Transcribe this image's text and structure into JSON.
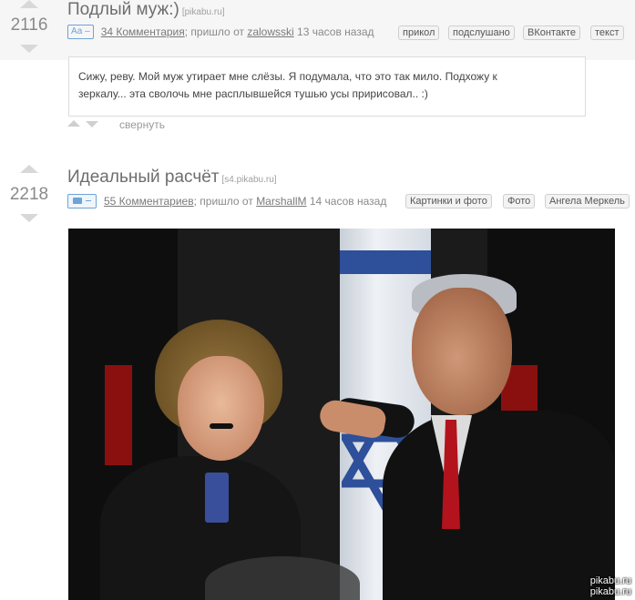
{
  "post1": {
    "rating": "2116",
    "title": "Подлый муж:)",
    "source": "[pikabu.ru]",
    "type_badge": "Аа –",
    "comments_link": "34 Комментария",
    "via_text": "; пришло от",
    "author": "zalowsski",
    "time": "13 часов назад",
    "tags": [
      "прикол",
      "подслушано",
      "ВКонтакте",
      "текст"
    ],
    "story_lines": [
      "Сижу, реву. Мой муж утирает мне слёзы. Я подумала, что это так мило. Подхожу к",
      "зеркалу... эта сволочь мне расплывшейся тушью усы пририсовал.. :)"
    ],
    "collapse_label": "свернуть"
  },
  "post2": {
    "rating": "2218",
    "title": "Идеальный расчёт",
    "source": "[s4.pikabu.ru]",
    "comments_link": "55 Комментариев",
    "via_text": "; пришло от",
    "author": "MarshallM",
    "time": "14 часов назад",
    "tags": [
      "Картинки и фото",
      "Фото",
      "Ангела Меркель"
    ],
    "photo_watermark_1": "pikabu.ru",
    "photo_watermark_2": "pikabu.ru"
  }
}
